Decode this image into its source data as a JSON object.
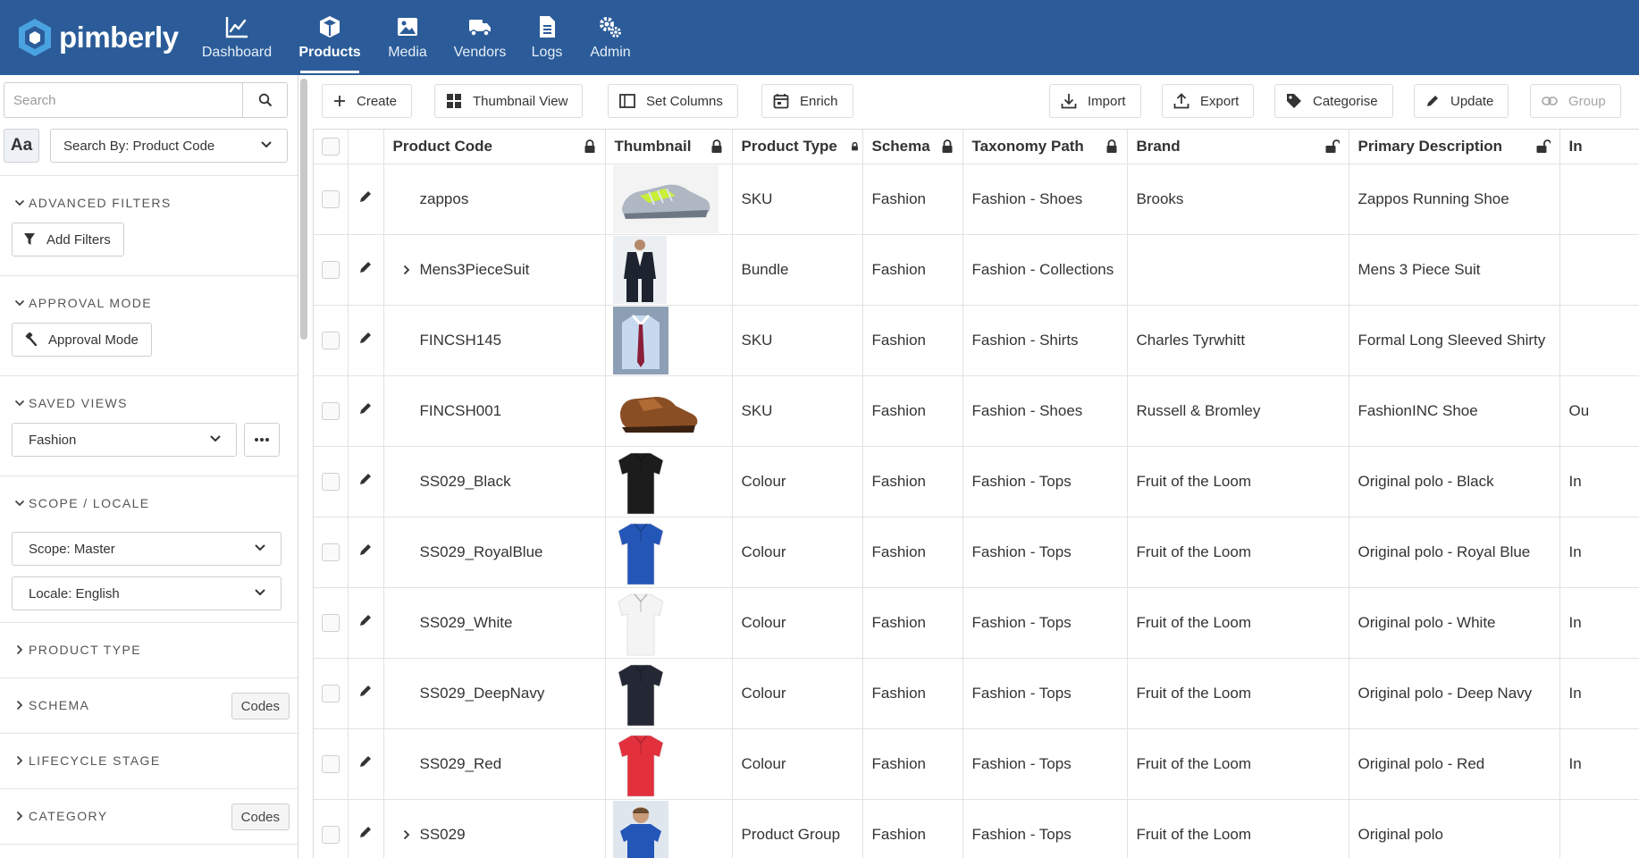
{
  "app": {
    "brand": "pimberly",
    "brand_color": "#2b5c99"
  },
  "nav": [
    {
      "label": "Dashboard",
      "icon": "chart-line-icon"
    },
    {
      "label": "Products",
      "icon": "cube-icon",
      "active": true
    },
    {
      "label": "Media",
      "icon": "image-icon"
    },
    {
      "label": "Vendors",
      "icon": "truck-icon"
    },
    {
      "label": "Logs",
      "icon": "document-icon"
    },
    {
      "label": "Admin",
      "icon": "gears-icon"
    }
  ],
  "sidebar": {
    "search_placeholder": "Search",
    "aa_label": "Aa",
    "search_by": "Search By: Product Code",
    "advanced_filters": {
      "title": "ADVANCED FILTERS",
      "button": "Add Filters"
    },
    "approval_mode": {
      "title": "APPROVAL MODE",
      "button": "Approval Mode"
    },
    "saved_views": {
      "title": "SAVED VIEWS",
      "selected": "Fashion"
    },
    "scope_locale": {
      "title": "SCOPE / LOCALE",
      "scope": "Scope: Master",
      "locale": "Locale: English"
    },
    "collapsed_sections": [
      {
        "title": "PRODUCT TYPE"
      },
      {
        "title": "SCHEMA",
        "button": "Codes"
      },
      {
        "title": "LIFECYCLE STAGE"
      },
      {
        "title": "CATEGORY",
        "button": "Codes"
      }
    ]
  },
  "toolbar": {
    "create": "Create",
    "thumbnail_view": "Thumbnail View",
    "set_columns": "Set Columns",
    "enrich": "Enrich",
    "import": "Import",
    "export": "Export",
    "categorise": "Categorise",
    "update": "Update",
    "group": "Group"
  },
  "table": {
    "columns": {
      "product_code": "Product Code",
      "thumbnail": "Thumbnail",
      "product_type": "Product Type",
      "schema": "Schema",
      "taxonomy_path": "Taxonomy Path",
      "brand": "Brand",
      "primary_description": "Primary Description",
      "next": "In"
    },
    "rows": [
      {
        "code": "zappos",
        "expandable": false,
        "thumb": "running-shoe",
        "type": "SKU",
        "schema": "Fashion",
        "taxonomy": "Fashion - Shoes",
        "brand": "Brooks",
        "description": "Zappos Running Shoe",
        "next": ""
      },
      {
        "code": "Mens3PieceSuit",
        "expandable": true,
        "thumb": "suit",
        "type": "Bundle",
        "schema": "Fashion",
        "taxonomy": "Fashion - Collections",
        "brand": "",
        "description": "Mens 3 Piece Suit",
        "next": ""
      },
      {
        "code": "FINCSH145",
        "expandable": false,
        "thumb": "shirt",
        "type": "SKU",
        "schema": "Fashion",
        "taxonomy": "Fashion - Shirts",
        "brand": "Charles Tyrwhitt",
        "description": "Formal Long Sleeved Shirty",
        "next": ""
      },
      {
        "code": "FINCSH001",
        "expandable": false,
        "thumb": "brogue",
        "type": "SKU",
        "schema": "Fashion",
        "taxonomy": "Fashion - Shoes",
        "brand": "Russell & Bromley",
        "description": "FashionINC Shoe",
        "next": "Ou"
      },
      {
        "code": "SS029_Black",
        "expandable": false,
        "thumb": "polo",
        "polo_color": "#1c1c1c",
        "type": "Colour",
        "schema": "Fashion",
        "taxonomy": "Fashion - Tops",
        "brand": "Fruit of the Loom",
        "description": "Original polo - Black",
        "next": "In"
      },
      {
        "code": "SS029_RoyalBlue",
        "expandable": false,
        "thumb": "polo",
        "polo_color": "#2456b8",
        "type": "Colour",
        "schema": "Fashion",
        "taxonomy": "Fashion - Tops",
        "brand": "Fruit of the Loom",
        "description": "Original polo - Royal Blue",
        "next": "In"
      },
      {
        "code": "SS029_White",
        "expandable": false,
        "thumb": "polo",
        "polo_color": "#f4f4f4",
        "type": "Colour",
        "schema": "Fashion",
        "taxonomy": "Fashion - Tops",
        "brand": "Fruit of the Loom",
        "description": "Original polo - White",
        "next": "In"
      },
      {
        "code": "SS029_DeepNavy",
        "expandable": false,
        "thumb": "polo",
        "polo_color": "#242835",
        "type": "Colour",
        "schema": "Fashion",
        "taxonomy": "Fashion - Tops",
        "brand": "Fruit of the Loom",
        "description": "Original polo - Deep Navy",
        "next": "In"
      },
      {
        "code": "SS029_Red",
        "expandable": false,
        "thumb": "polo",
        "polo_color": "#e3303d",
        "type": "Colour",
        "schema": "Fashion",
        "taxonomy": "Fashion - Tops",
        "brand": "Fruit of the Loom",
        "description": "Original polo - Red",
        "next": "In"
      },
      {
        "code": "SS029",
        "expandable": true,
        "thumb": "model-polo",
        "polo_color": "#2456b8",
        "type": "Product Group",
        "schema": "Fashion",
        "taxonomy": "Fashion - Tops",
        "brand": "Fruit of the Loom",
        "description": "Original polo",
        "next": ""
      }
    ]
  }
}
